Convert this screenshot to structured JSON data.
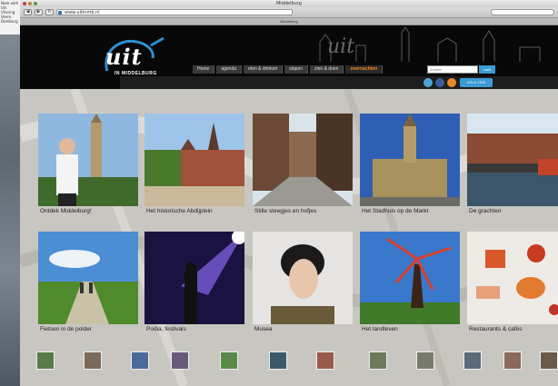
{
  "desktop": {
    "note_text": "Note with tim Vlissing Veere Domburg"
  },
  "browser": {
    "window_title": "Middelburg",
    "url": "www.uitinmb.nl",
    "tab_label": "Middelburg"
  },
  "site": {
    "logo_text": "uit",
    "logo_subtitle": "IN MIDDELBURG",
    "nav": [
      {
        "label": "Home"
      },
      {
        "label": "agenda"
      },
      {
        "label": "eten & drinken"
      },
      {
        "label": "slapen"
      },
      {
        "label": "zien & doen"
      },
      {
        "label": "overnachten"
      }
    ],
    "search_placeholder": "Zoeken",
    "search_button": "zoek",
    "social_button": "VOLG ONS"
  },
  "tiles": [
    {
      "caption": "Ontdek Middelburg!"
    },
    {
      "caption": "Het historische Abdijplein"
    },
    {
      "caption": "Stille steegjes en hofjes"
    },
    {
      "caption": "Het Stadhuis op de Markt"
    },
    {
      "caption": "De grachten"
    },
    {
      "caption": "Fietsen in de polder"
    },
    {
      "caption": "Podia, festivals"
    },
    {
      "caption": "Musea"
    },
    {
      "caption": "Het landleven"
    },
    {
      "caption": "Restaurants & cafés"
    }
  ],
  "colors": {
    "header_bg": "#080808",
    "nav_active": "#f28a1e",
    "accent_blue": "#3c9ad6"
  }
}
